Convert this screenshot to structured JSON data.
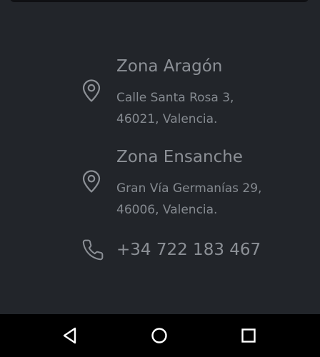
{
  "locations": [
    {
      "title": "Zona Aragón",
      "address_line1": "Calle Santa Rosa 3,",
      "address_line2": "46021, Valencia.",
      "icon": "map-pin-icon"
    },
    {
      "title": "Zona Ensanche",
      "address_line1": "Gran Vía Germanías 29,",
      "address_line2": "46006, Valencia.",
      "icon": "map-pin-icon"
    }
  ],
  "phone": {
    "number": "+34 722 183 467",
    "icon": "phone-icon"
  },
  "navigation_bar": {
    "buttons": [
      "back-icon",
      "home-icon",
      "recents-icon"
    ]
  },
  "colors": {
    "background": "#22252a",
    "text": "#8c9096",
    "icon": "#8c9096",
    "nav_background": "#000000",
    "nav_icon": "#ffffff"
  }
}
